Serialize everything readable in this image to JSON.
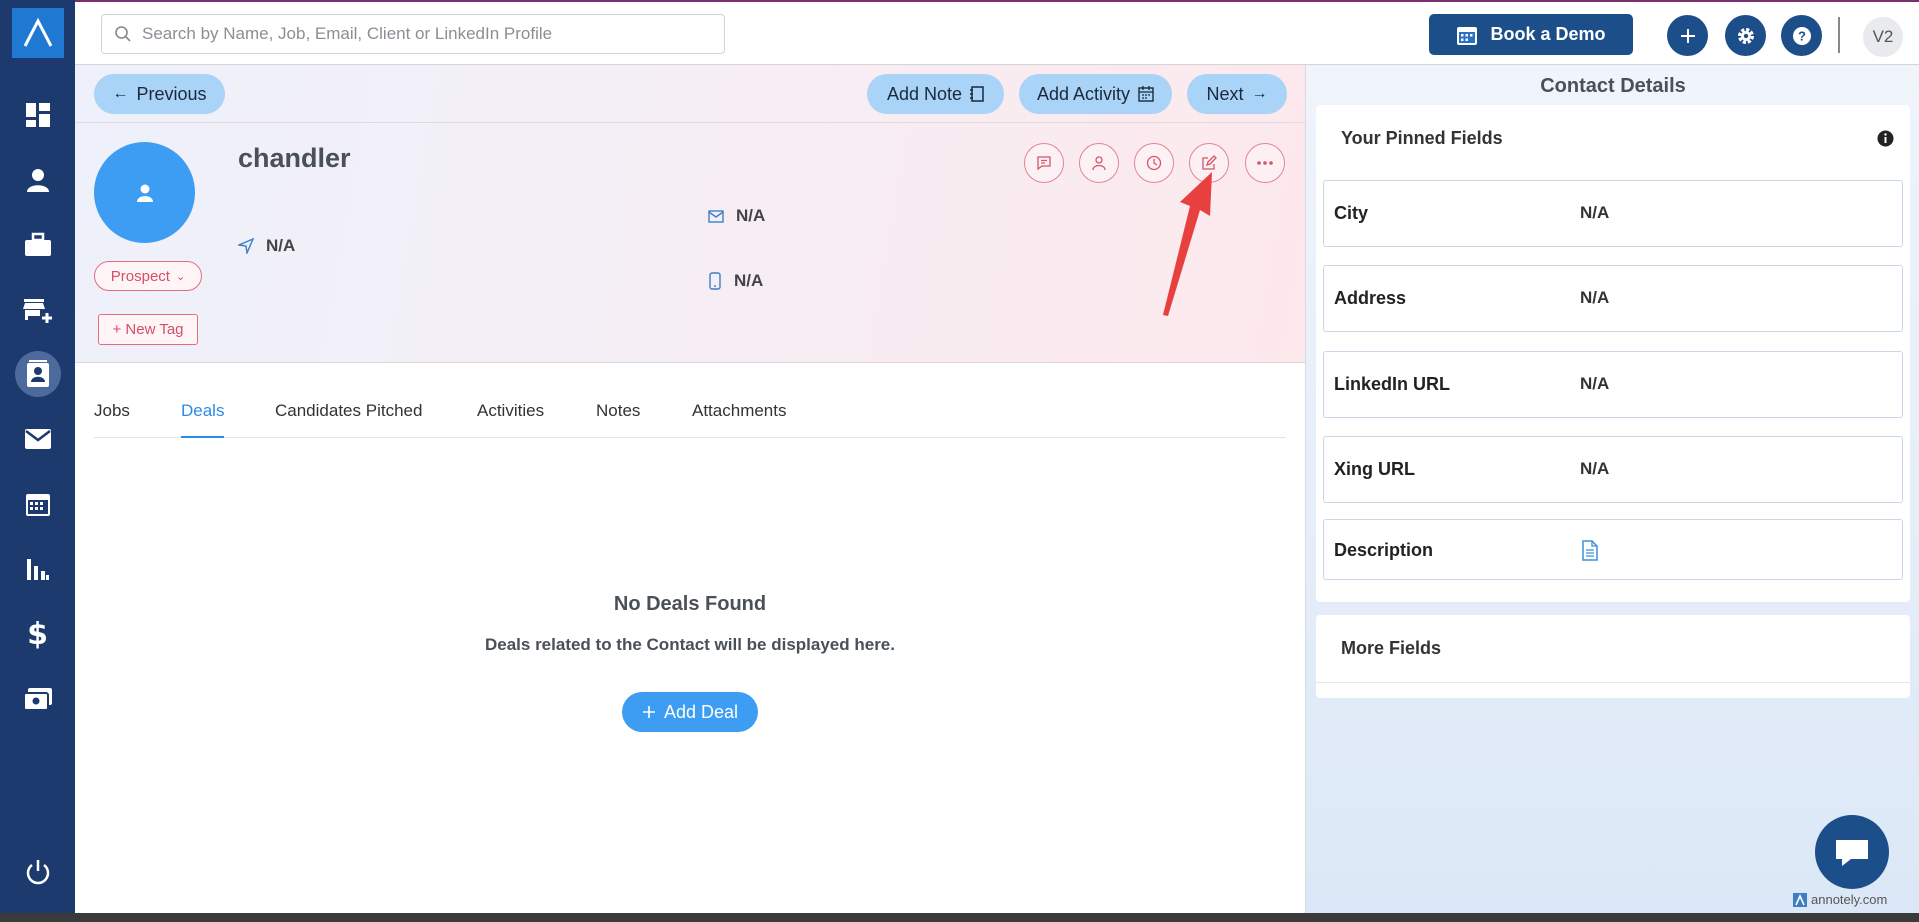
{
  "topbar": {
    "search_placeholder": "Search by Name, Job, Email, Client or LinkedIn Profile",
    "book_demo_label": "Book a Demo",
    "user_initials": "V2"
  },
  "sidebar": {
    "items": [
      {
        "icon": "dashboard-icon"
      },
      {
        "icon": "person-icon"
      },
      {
        "icon": "briefcase-icon"
      },
      {
        "icon": "store-add-icon"
      },
      {
        "icon": "contacts-icon",
        "active": true
      },
      {
        "icon": "mail-icon"
      },
      {
        "icon": "calendar-icon"
      },
      {
        "icon": "reports-icon"
      },
      {
        "icon": "dollar-icon"
      },
      {
        "icon": "payments-icon"
      }
    ],
    "power_icon": "power-icon"
  },
  "contact": {
    "previous_label": "Previous",
    "next_label": "Next",
    "add_note_label": "Add Note",
    "add_activity_label": "Add Activity",
    "name": "chandler",
    "location": "N/A",
    "email": "N/A",
    "phone": "N/A",
    "status": "Prospect",
    "new_tag_label": "+ New Tag"
  },
  "tabs": [
    {
      "label": "Jobs"
    },
    {
      "label": "Deals",
      "active": true
    },
    {
      "label": "Candidates Pitched"
    },
    {
      "label": "Activities"
    },
    {
      "label": "Notes"
    },
    {
      "label": "Attachments"
    }
  ],
  "deals": {
    "empty_title": "No Deals Found",
    "empty_subtitle": "Deals related to the Contact will be displayed here.",
    "add_deal_label": "Add Deal"
  },
  "right_panel": {
    "title": "Contact Details",
    "pinned_title": "Your Pinned Fields",
    "fields": [
      {
        "label": "City",
        "value": "N/A"
      },
      {
        "label": "Address",
        "value": "N/A"
      },
      {
        "label": "LinkedIn URL",
        "value": "N/A"
      },
      {
        "label": "Xing URL",
        "value": "N/A"
      },
      {
        "label": "Description",
        "value": ""
      }
    ],
    "more_fields_title": "More Fields"
  },
  "watermark": "annotely.com",
  "colors": {
    "sidebar": "#1c3a6e",
    "primary": "#1c4e8a",
    "accent_blue": "#3d9df2",
    "pill_blue": "#a9d3f7",
    "tag_red": "#d34f66",
    "arrow_red": "#e8403f"
  }
}
